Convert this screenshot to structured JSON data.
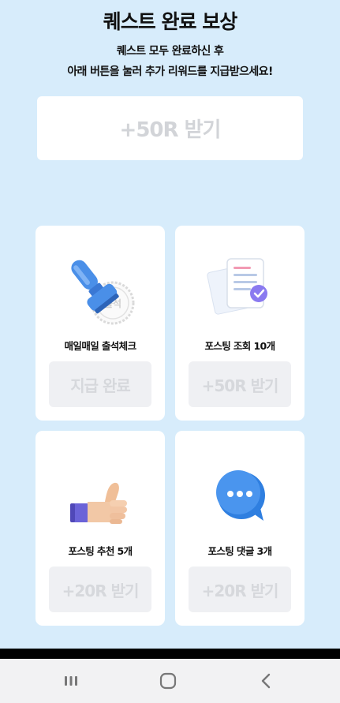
{
  "header": {
    "title": "퀘스트 완료 보상",
    "subtitle_line1": "퀘스트 모두 완료하신 후",
    "subtitle_line2": "아래 버튼을 눌러 추가 리워드를 지급받으세요!"
  },
  "main_reward": {
    "button_label": "+50R 받기"
  },
  "quests": [
    {
      "icon": "attendance-stamp-icon",
      "stamp_text": "출석",
      "label": "매일매일 출석체크",
      "button_label": "지급 완료"
    },
    {
      "icon": "documents-check-icon",
      "label": "포스팅 조회 10개",
      "button_label": "+50R 받기"
    },
    {
      "icon": "thumbs-up-icon",
      "label": "포스팅 추천 5개",
      "button_label": "+20R 받기"
    },
    {
      "icon": "chat-bubble-icon",
      "label": "포스팅 댓글 3개",
      "button_label": "+20R 받기"
    }
  ],
  "navigation": {
    "icons": [
      "recent-apps-icon",
      "home-icon",
      "back-icon"
    ]
  },
  "colors": {
    "background": "#d7ecfb",
    "card": "#ffffff",
    "disabled_text": "#d2d4d8",
    "disabled_button": "#eff0f3",
    "accent_blue": "#4a8fe8"
  }
}
